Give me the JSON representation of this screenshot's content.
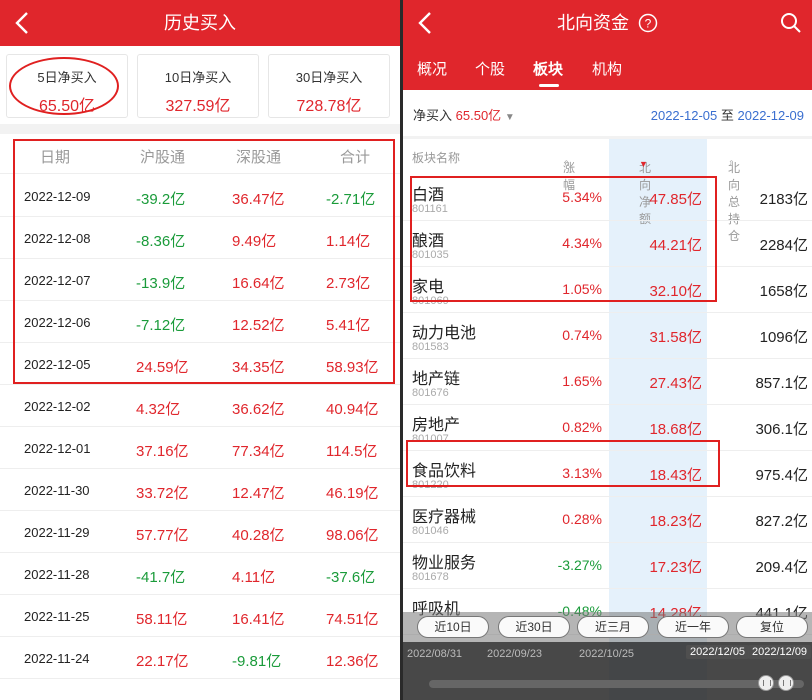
{
  "left": {
    "title": "历史买入",
    "summary": [
      {
        "label": "5日净买入",
        "value": "65.50亿"
      },
      {
        "label": "10日净买入",
        "value": "327.59亿"
      },
      {
        "label": "30日净买入",
        "value": "728.78亿"
      }
    ],
    "headers": [
      "日期",
      "沪股通",
      "深股通",
      "合计"
    ],
    "rows": [
      {
        "date": "2022-12-09",
        "sh": "-39.2亿",
        "sz": "36.47亿",
        "total": "-2.71亿"
      },
      {
        "date": "2022-12-08",
        "sh": "-8.36亿",
        "sz": "9.49亿",
        "total": "1.14亿"
      },
      {
        "date": "2022-12-07",
        "sh": "-13.9亿",
        "sz": "16.64亿",
        "total": "2.73亿"
      },
      {
        "date": "2022-12-06",
        "sh": "-7.12亿",
        "sz": "12.52亿",
        "total": "5.41亿"
      },
      {
        "date": "2022-12-05",
        "sh": "24.59亿",
        "sz": "34.35亿",
        "total": "58.93亿"
      },
      {
        "date": "2022-12-02",
        "sh": "4.32亿",
        "sz": "36.62亿",
        "total": "40.94亿"
      },
      {
        "date": "2022-12-01",
        "sh": "37.16亿",
        "sz": "77.34亿",
        "total": "114.5亿"
      },
      {
        "date": "2022-11-30",
        "sh": "33.72亿",
        "sz": "12.47亿",
        "total": "46.19亿"
      },
      {
        "date": "2022-11-29",
        "sh": "57.77亿",
        "sz": "40.28亿",
        "total": "98.06亿"
      },
      {
        "date": "2022-11-28",
        "sh": "-41.7亿",
        "sz": "4.11亿",
        "total": "-37.6亿"
      },
      {
        "date": "2022-11-25",
        "sh": "58.11亿",
        "sz": "16.41亿",
        "total": "74.51亿"
      },
      {
        "date": "2022-11-24",
        "sh": "22.17亿",
        "sz": "-9.81亿",
        "total": "12.36亿"
      }
    ]
  },
  "right": {
    "title": "北向资金",
    "tabs": [
      "概况",
      "个股",
      "板块",
      "机构"
    ],
    "active_tab": 2,
    "net_buy_label": "净买入",
    "net_buy_value": "65.50亿",
    "date_from": "2022-12-05",
    "date_to_word": "至",
    "date_to": "2022-12-09",
    "headers": [
      "板块名称",
      "涨幅",
      "北向净额",
      "北向总持仓"
    ],
    "rows": [
      {
        "name": "白酒",
        "code": "801161",
        "chg": "5.34%",
        "flow": "47.85亿",
        "hold": "2183亿"
      },
      {
        "name": "酿酒",
        "code": "801035",
        "chg": "4.34%",
        "flow": "44.21亿",
        "hold": "2284亿"
      },
      {
        "name": "家电",
        "code": "801069",
        "chg": "1.05%",
        "flow": "32.10亿",
        "hold": "1658亿"
      },
      {
        "name": "动力电池",
        "code": "801583",
        "chg": "0.74%",
        "flow": "31.58亿",
        "hold": "1096亿"
      },
      {
        "name": "地产链",
        "code": "801676",
        "chg": "1.65%",
        "flow": "27.43亿",
        "hold": "857.1亿"
      },
      {
        "name": "房地产",
        "code": "801007",
        "chg": "0.82%",
        "flow": "18.68亿",
        "hold": "306.1亿"
      },
      {
        "name": "食品饮料",
        "code": "801220",
        "chg": "3.13%",
        "flow": "18.43亿",
        "hold": "975.4亿"
      },
      {
        "name": "医疗器械",
        "code": "801046",
        "chg": "0.28%",
        "flow": "18.23亿",
        "hold": "827.2亿"
      },
      {
        "name": "物业服务",
        "code": "801678",
        "chg": "-3.27%",
        "flow": "17.23亿",
        "hold": "209.4亿"
      },
      {
        "name": "呼吸机",
        "code": "",
        "chg": "-0.48%",
        "flow": "14.28亿",
        "hold": "441.1亿"
      }
    ],
    "range_buttons": [
      "近10日",
      "近30日",
      "近三月",
      "近一年",
      "复位"
    ],
    "timeline_labels": [
      "2022/08/31",
      "2022/09/23",
      "2022/10/25"
    ],
    "range_start_tag": "2022/12/05",
    "range_end_tag": "2022/12/09",
    "colors": {
      "brand": "#e0262c",
      "up": "#e0262c",
      "down": "#1a9b3a",
      "link": "#3a6fd0"
    }
  }
}
